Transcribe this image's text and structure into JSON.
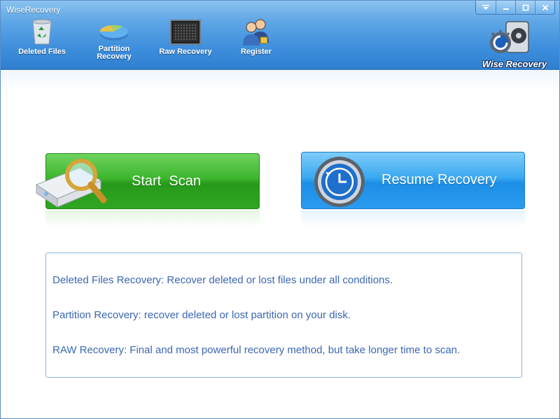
{
  "window": {
    "title": "WiseRecovery"
  },
  "toolbar": {
    "items": [
      {
        "label": "Deleted Files",
        "icon": "recycle-bin-icon"
      },
      {
        "label": "Partition\nRecovery",
        "icon": "pie-chart-icon"
      },
      {
        "label": "Raw Recovery",
        "icon": "monitor-icon"
      },
      {
        "label": "Register",
        "icon": "users-icon"
      }
    ]
  },
  "logo": {
    "text": "Wise Recovery"
  },
  "actions": {
    "start_scan": "Start  Scan",
    "resume_recovery": "Resume Recovery"
  },
  "info": {
    "lines": [
      "Deleted Files Recovery: Recover deleted or lost files  under all conditions.",
      "Partition Recovery: recover deleted or lost partition on your disk.",
      "RAW Recovery: Final and most powerful recovery method, but take longer time to scan."
    ]
  },
  "colors": {
    "header": "#3d8edc",
    "scan_button": "#3db52d",
    "resume_button": "#2a9bef",
    "info_text": "#3b67b3"
  }
}
